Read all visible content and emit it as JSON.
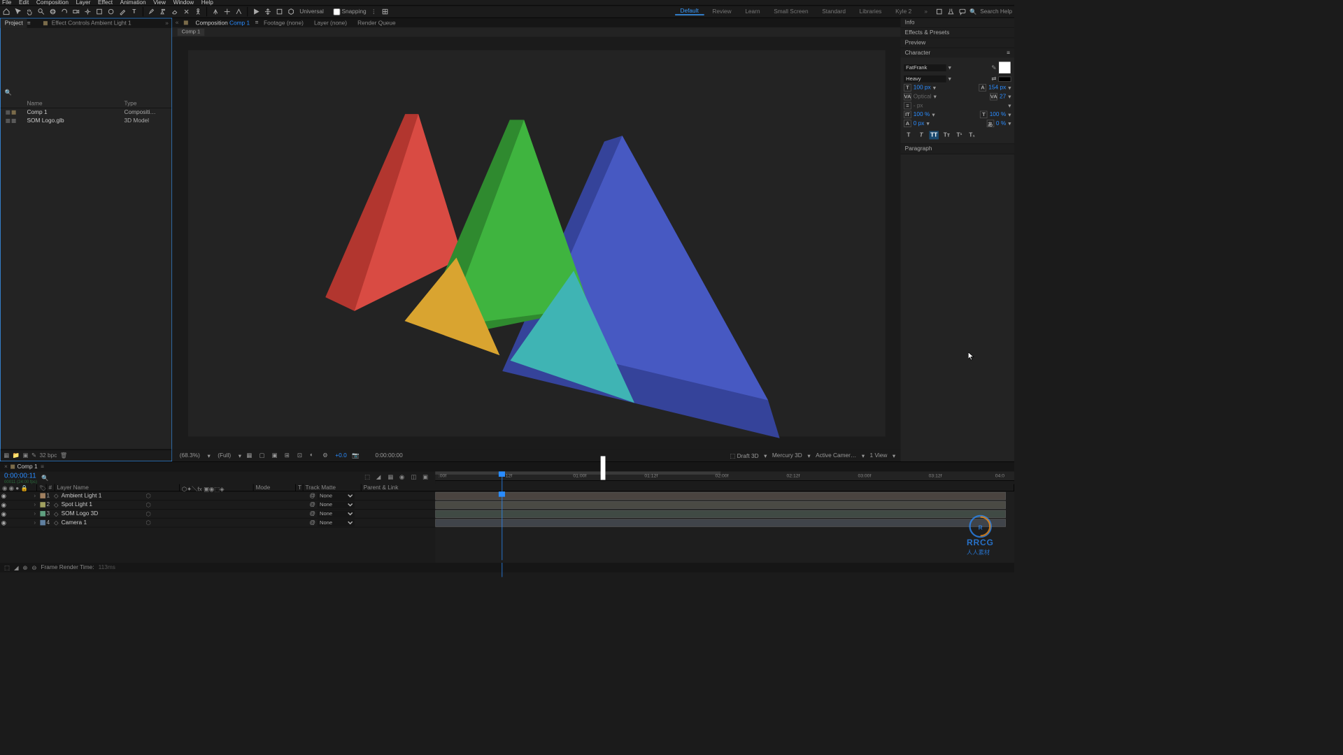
{
  "menu": {
    "items": [
      "File",
      "Edit",
      "Composition",
      "Layer",
      "Effect",
      "Animation",
      "View",
      "Window",
      "Help"
    ]
  },
  "toolbar": {
    "universal": "Universal",
    "snapping": "Snapping",
    "workspaces": [
      "Default",
      "Review",
      "Learn",
      "Small Screen",
      "Standard",
      "Libraries",
      "Kyle 2"
    ],
    "active_ws": 0,
    "search_placeholder": "Search Help"
  },
  "left": {
    "tab_project": "Project",
    "tab_effect": "Effect Controls Ambient Light 1",
    "columns": {
      "name": "Name",
      "type": "Type"
    },
    "rows": [
      {
        "name": "Comp 1",
        "type": "Compositi…"
      },
      {
        "name": "SOM Logo.glb",
        "type": "3D Model"
      }
    ],
    "bpc": "32 bpc"
  },
  "center": {
    "tab_comp_prefix": "Composition",
    "tab_comp_name": "Comp 1",
    "tab_footage": "Footage (none)",
    "tab_layer": "Layer (none)",
    "tab_render": "Render Queue",
    "crumb": "Comp 1",
    "footer": {
      "zoom": "(68.3%)",
      "res": "(Full)",
      "exposure": "+0.0",
      "time": "0:00:00:00",
      "draft": "Draft 3D",
      "renderer": "Mercury 3D",
      "camera": "Active Camer…",
      "views": "1 View"
    }
  },
  "right": {
    "info": "Info",
    "effects": "Effects & Presets",
    "preview": "Preview",
    "character": "Character",
    "paragraph": "Paragraph",
    "font": "FatFrank",
    "style": "Heavy",
    "size": "100 px",
    "leading": "154 px",
    "kerning": "Optical",
    "tracking": "27",
    "stroke": "- px",
    "vscale": "100 %",
    "hscale": "100 %",
    "baseline": "0 px",
    "tsume": "0 %"
  },
  "timeline": {
    "tab": "Comp 1",
    "timecode": "0:00:00:11",
    "subframe": "00011 (24:00 fps)",
    "cols": {
      "layer_name": "Layer Name",
      "mode": "Mode",
      "track_matte": "Track Matte",
      "parent": "Parent & Link"
    },
    "ticks": [
      ":00f",
      "12f",
      "01:00f",
      "01:12f",
      "02:00f",
      "02:12f",
      "03:00f",
      "03:12f",
      "04:0"
    ],
    "layers": [
      {
        "num": "1",
        "name": "Ambient Light 1",
        "color": "#a08060",
        "parent": "None"
      },
      {
        "num": "2",
        "name": "Spot Light 1",
        "color": "#a0a060",
        "parent": "None"
      },
      {
        "num": "3",
        "name": "SOM Logo 3D",
        "color": "#60a080",
        "parent": "None"
      },
      {
        "num": "4",
        "name": "Camera 1",
        "color": "#6080a0",
        "parent": "None"
      }
    ],
    "render_time_label": "Frame Render Time:",
    "render_time": "113ms"
  },
  "watermark": {
    "big": "RRCG",
    "small": "人人素材"
  }
}
